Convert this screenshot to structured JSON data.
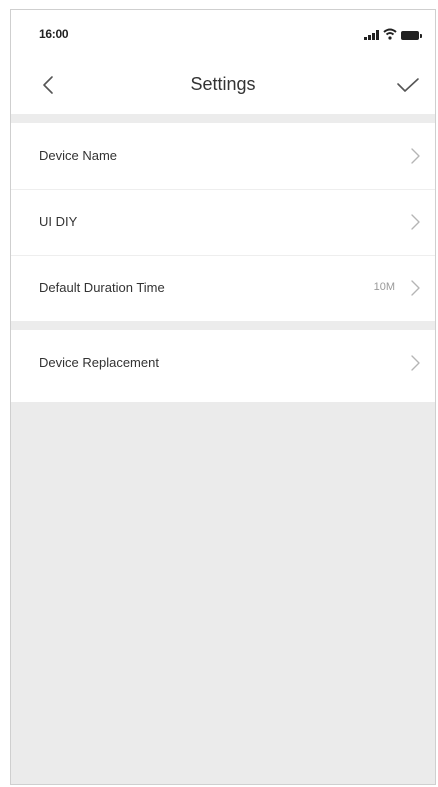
{
  "status_bar": {
    "time": "16:00",
    "icons": [
      "signal-icon",
      "wifi-icon",
      "battery-icon"
    ]
  },
  "nav": {
    "title": "Settings",
    "back_icon": "chevron-left-icon",
    "confirm_icon": "checkmark-icon"
  },
  "settings": {
    "group1": [
      {
        "label": "Device Name",
        "value": ""
      },
      {
        "label": "UI DIY",
        "value": ""
      },
      {
        "label": "Default Duration Time",
        "value": "10M"
      }
    ],
    "group2": [
      {
        "label": "Device Replacement",
        "value": ""
      }
    ]
  },
  "colors": {
    "background": "#ffffff",
    "separator": "#ececec",
    "text": "#333333",
    "muted": "#9a9a9a"
  }
}
